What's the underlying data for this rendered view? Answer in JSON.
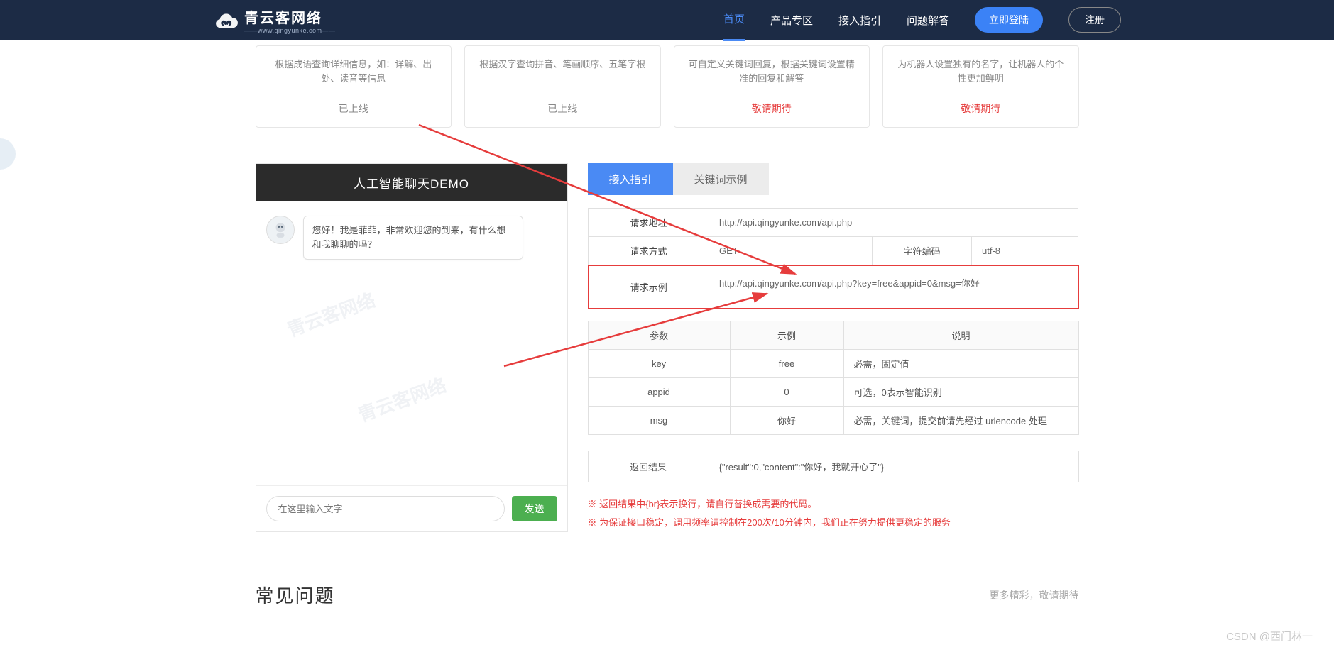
{
  "header": {
    "brand": "青云客网络",
    "brand_sub": "——www.qingyunke.com——",
    "nav": [
      "首页",
      "产品专区",
      "接入指引",
      "问题解答"
    ],
    "login": "立即登陆",
    "register": "注册"
  },
  "cards": [
    {
      "desc": "根据成语查询详细信息，如：详解、出处、读音等信息",
      "status": "已上线",
      "pending": false
    },
    {
      "desc": "根据汉字查询拼音、笔画顺序、五笔字根",
      "status": "已上线",
      "pending": false
    },
    {
      "desc": "可自定义关键词回复，根据关键词设置精准的回复和解答",
      "status": "敬请期待",
      "pending": true
    },
    {
      "desc": "为机器人设置独有的名字，让机器人的个性更加鲜明",
      "status": "敬请期待",
      "pending": true
    }
  ],
  "chat": {
    "header": "人工智能聊天DEMO",
    "greeting": "您好！我是菲菲，非常欢迎您的到来，有什么想和我聊聊的吗？",
    "placeholder": "在这里输入文字",
    "send": "发送"
  },
  "tabs": {
    "guide": "接入指引",
    "keywords": "关键词示例"
  },
  "api": {
    "url_label": "请求地址",
    "url": "http://api.qingyunke.com/api.php",
    "method_label": "请求方式",
    "method": "GET",
    "charset_label": "字符编码",
    "charset": "utf-8",
    "example_label": "请求示例",
    "example": "http://api.qingyunke.com/api.php?key=free&appid=0&msg=你好",
    "params_header": {
      "param": "参数",
      "example": "示例",
      "desc": "说明"
    },
    "params": [
      {
        "name": "key",
        "example": "free",
        "desc": "必需，固定值"
      },
      {
        "name": "appid",
        "example": "0",
        "desc": "可选，0表示智能识别"
      },
      {
        "name": "msg",
        "example": "你好",
        "desc": "必需，关键词，提交前请先经过 urlencode 处理"
      }
    ],
    "return_label": "返回结果",
    "return_value": "{\"result\":0,\"content\":\"你好，我就开心了\"}",
    "notes": [
      "※ 返回结果中{br}表示换行，请自行替换成需要的代码。",
      "※ 为保证接口稳定，调用频率请控制在200次/10分钟内，我们正在努力提供更稳定的服务"
    ]
  },
  "faq": {
    "title": "常见问题",
    "more": "更多精彩，敬请期待"
  },
  "csdn": "CSDN @西门林一"
}
